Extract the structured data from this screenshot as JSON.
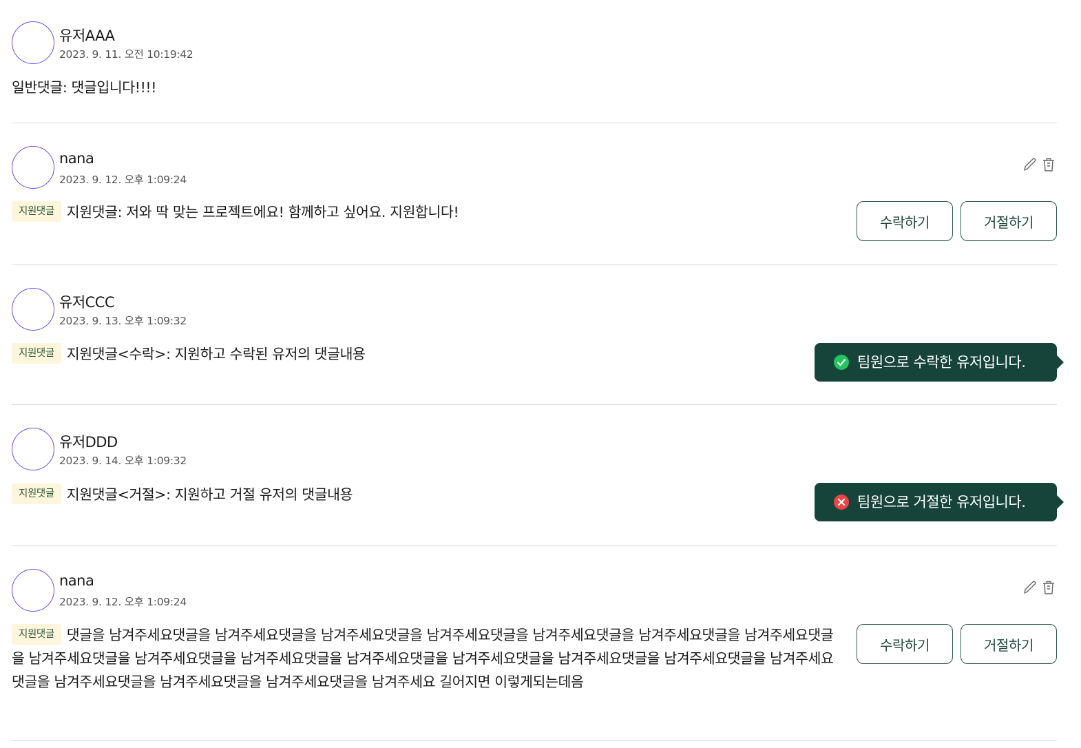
{
  "comments": [
    {
      "username": "유저AAA",
      "timestamp": "2023. 9. 11. 오전 10:19:42",
      "content": "일반댓글: 댓글입니다!!!!"
    },
    {
      "username": "nana",
      "timestamp": "2023. 9. 12. 오후 1:09:24",
      "tag": "지원댓글",
      "content": "지원댓글: 저와 딱 맞는 프로젝트에요! 함께하고 싶어요. 지원합니다!",
      "accept_label": "수락하기",
      "reject_label": "거절하기",
      "edit_icon": "pencil-icon",
      "delete_icon": "trash-icon"
    },
    {
      "username": "유저CCC",
      "timestamp": "2023. 9. 13. 오후 1:09:32",
      "tag": "지원댓글",
      "content": "지원댓글<수락>: 지원하고 수락된 유저의 댓글내용",
      "status_text": "팀원으로 수락한 유저입니다.",
      "status_icon": "check-circle-icon",
      "status_color": "#22c55e"
    },
    {
      "username": "유저DDD",
      "timestamp": "2023. 9. 14. 오후 1:09:32",
      "tag": "지원댓글",
      "content": "지원댓글<거절>: 지원하고 거절 유저의 댓글내용",
      "status_text": "팀원으로 거절한 유저입니다.",
      "status_icon": "x-circle-icon",
      "status_color": "#ef4444"
    },
    {
      "username": "nana",
      "timestamp": "2023. 9. 12. 오후 1:09:24",
      "tag": "지원댓글",
      "content": "댓글을 남겨주세요댓글을 남겨주세요댓글을 남겨주세요댓글을 남겨주세요댓글을 남겨주세요댓글을 남겨주세요댓글을 남겨주세요댓글을 남겨주세요댓글을 남겨주세요댓글을 남겨주세요댓글을 남겨주세요댓글을 남겨주세요댓글을 남겨주세요댓글을 남겨주세요댓글을 남겨주세요댓글을 남겨주세요댓글을 남겨주세요댓글을 남겨주세요댓글을 남겨주세요 길어지면 이렇게되는데음",
      "accept_label": "수락하기",
      "reject_label": "거절하기",
      "edit_icon": "pencil-icon",
      "delete_icon": "trash-icon"
    }
  ],
  "colors": {
    "avatar_border": "#5b4ff5",
    "button_border": "#2f5948",
    "status_background": "#17443a",
    "tag_background": "#fdf6dc",
    "divider": "#d9d9d9"
  }
}
